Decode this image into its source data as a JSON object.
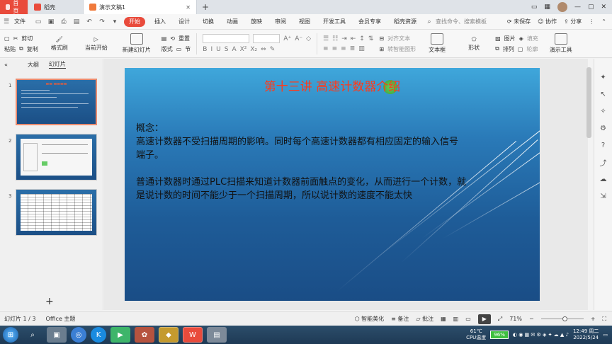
{
  "tabbar": {
    "home_label": "首页",
    "tab1_label": "稻壳",
    "tab2_label": "演示文稿1",
    "unsaved_label": "未保存",
    "collab_label": "协作",
    "share_label": "分享"
  },
  "menubar": {
    "file_label": "文件",
    "items": [
      "开始",
      "插入",
      "设计",
      "切换",
      "动画",
      "放映",
      "审阅",
      "视图",
      "开发工具",
      "会员专享",
      "稻壳资源"
    ],
    "search_placeholder": "查找命令、搜索模板"
  },
  "ribbon": {
    "paste": "粘贴",
    "cut": "剪切",
    "copy": "复制",
    "format_painter": "格式刷",
    "play_current": "当前开始",
    "new_slide": "新建幻灯片",
    "layout": "版式",
    "section": "节",
    "reset": "重置",
    "align_text": "对齐文本",
    "convert_smartart": "转智能图形",
    "textbox": "文本框",
    "shape": "形状",
    "picture": "图片",
    "fill": "填充",
    "arrange": "排列",
    "outline": "轮廓",
    "presentation_tool": "演示工具"
  },
  "leftpanel": {
    "outline_tab": "大纲",
    "slides_tab": "幻灯片",
    "slide_numbers": [
      "1",
      "2",
      "3"
    ]
  },
  "slide": {
    "title": "第十三讲  高速计数器介绍",
    "para1_line1": "概念：",
    "para1_line2": "高速计数器不受扫描周期的影响。同时每个高速计数器都有相应固定的输入信号",
    "para1_line3": "端子。",
    "para2_line1": "普通计数器时通过PLC扫描来知道计数器前面触点的变化，从而进行一个计数，就",
    "para2_line2": "是说计数的时间不能少于一个扫描周期，所以说计数的速度不能太快"
  },
  "statusbar": {
    "slide_info": "幻灯片 1 / 3",
    "theme": "Office 主题",
    "beautify": "智能美化",
    "notes": "备注",
    "comments": "批注",
    "zoom": "71%"
  },
  "taskbar": {
    "cpu_temp": "61℃",
    "cpu_label": "CPU温度",
    "battery": "96%",
    "time": "12:49 周二",
    "date": "2022/5/24"
  },
  "colors": {
    "accent": "#e94b3c",
    "slide_title": "#ff3a1a",
    "slide_bg_top": "#3fa7db",
    "slide_bg_bottom": "#1a4d86"
  }
}
